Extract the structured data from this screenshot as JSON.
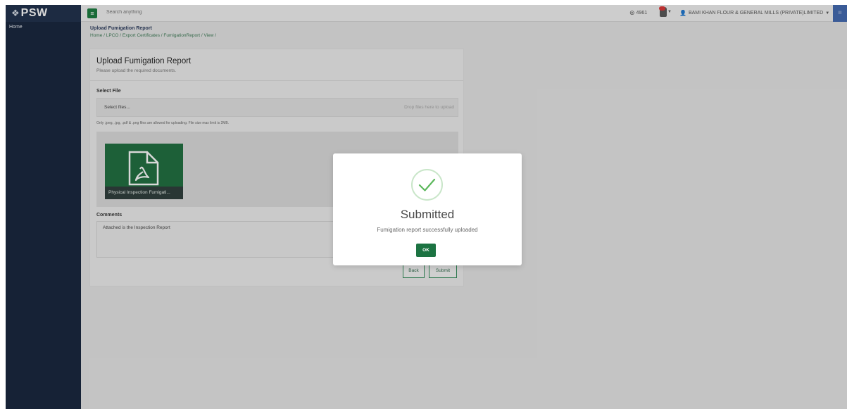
{
  "sidebar": {
    "logo_text": "PSW",
    "items": [
      {
        "label": "Home"
      }
    ]
  },
  "topbar": {
    "search_placeholder": "Search anything",
    "counter_value": "4961",
    "user_name": "BAMI KHAN FLOUR & GENERAL MILLS (PRIVATE)LIMITED",
    "avatar_initials": "III"
  },
  "header": {
    "title": "Upload Fumigation Report",
    "breadcrumb": "Home / LPCO / Export Certificates / FumigationReport / View /"
  },
  "form": {
    "title": "Upload Fumigation Report",
    "subtitle": "Please upload the required documents.",
    "select_file_label": "Select File",
    "select_files_button": "Select files...",
    "drop_hint": "Drop files here to upload",
    "file_hint": "Only .jpeg, .jpg, .pdf & .png files are allowed for uploading. File size max limit is 2MB.",
    "uploaded_file_name": "Physical Inspection Fumigati...",
    "comments_label": "Comments",
    "comments_value": "Attached is the Inspection Report",
    "back_button": "Back",
    "submit_button": "Submit"
  },
  "modal": {
    "title": "Submitted",
    "message": "Fumigation report successfully uploaded",
    "ok_button": "OK"
  },
  "colors": {
    "sidebar_bg": "#13223a",
    "accent_green": "#1c7342",
    "check_green": "#5cb85c"
  }
}
